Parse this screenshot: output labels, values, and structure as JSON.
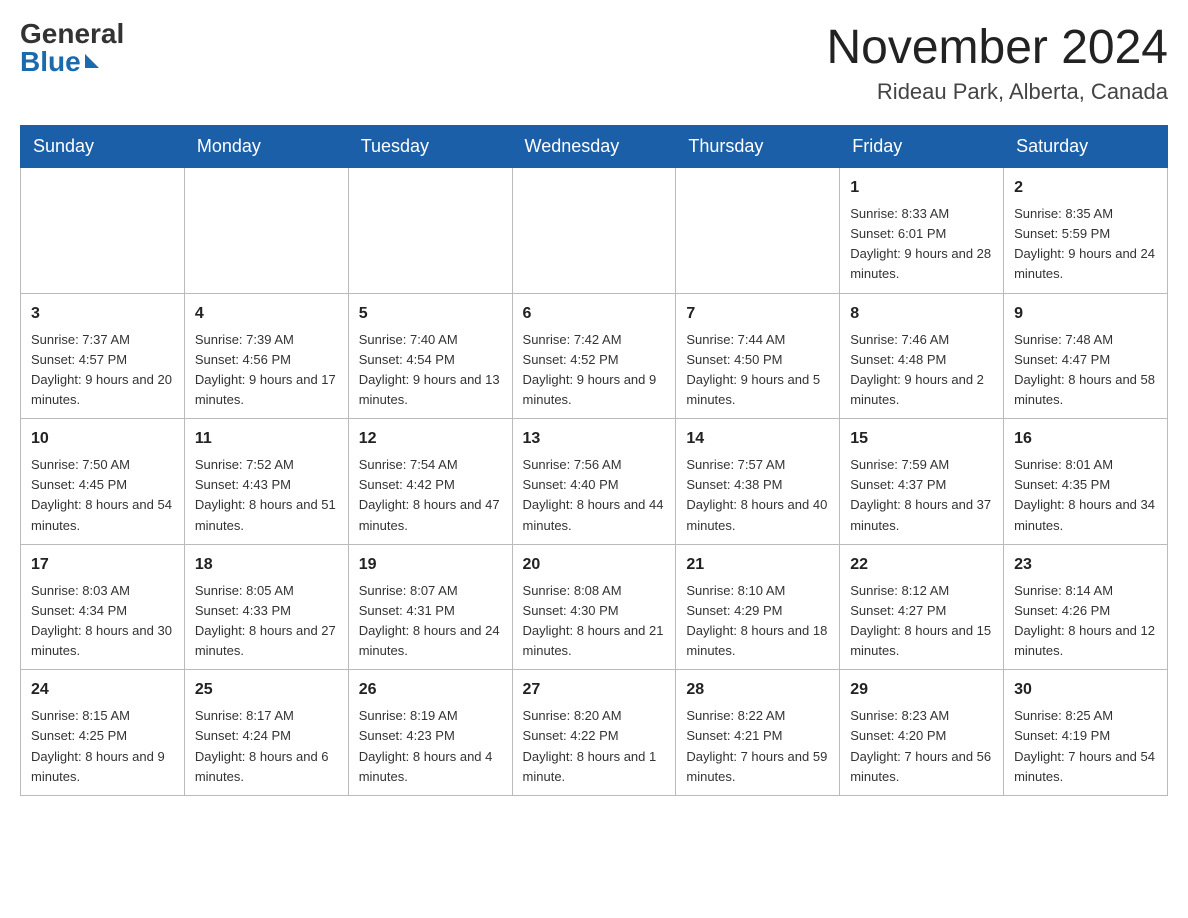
{
  "logo": {
    "general": "General",
    "blue": "Blue"
  },
  "header": {
    "month_title": "November 2024",
    "location": "Rideau Park, Alberta, Canada"
  },
  "weekdays": [
    "Sunday",
    "Monday",
    "Tuesday",
    "Wednesday",
    "Thursday",
    "Friday",
    "Saturday"
  ],
  "weeks": [
    [
      {
        "day": "",
        "info": ""
      },
      {
        "day": "",
        "info": ""
      },
      {
        "day": "",
        "info": ""
      },
      {
        "day": "",
        "info": ""
      },
      {
        "day": "",
        "info": ""
      },
      {
        "day": "1",
        "info": "Sunrise: 8:33 AM\nSunset: 6:01 PM\nDaylight: 9 hours and 28 minutes."
      },
      {
        "day": "2",
        "info": "Sunrise: 8:35 AM\nSunset: 5:59 PM\nDaylight: 9 hours and 24 minutes."
      }
    ],
    [
      {
        "day": "3",
        "info": "Sunrise: 7:37 AM\nSunset: 4:57 PM\nDaylight: 9 hours and 20 minutes."
      },
      {
        "day": "4",
        "info": "Sunrise: 7:39 AM\nSunset: 4:56 PM\nDaylight: 9 hours and 17 minutes."
      },
      {
        "day": "5",
        "info": "Sunrise: 7:40 AM\nSunset: 4:54 PM\nDaylight: 9 hours and 13 minutes."
      },
      {
        "day": "6",
        "info": "Sunrise: 7:42 AM\nSunset: 4:52 PM\nDaylight: 9 hours and 9 minutes."
      },
      {
        "day": "7",
        "info": "Sunrise: 7:44 AM\nSunset: 4:50 PM\nDaylight: 9 hours and 5 minutes."
      },
      {
        "day": "8",
        "info": "Sunrise: 7:46 AM\nSunset: 4:48 PM\nDaylight: 9 hours and 2 minutes."
      },
      {
        "day": "9",
        "info": "Sunrise: 7:48 AM\nSunset: 4:47 PM\nDaylight: 8 hours and 58 minutes."
      }
    ],
    [
      {
        "day": "10",
        "info": "Sunrise: 7:50 AM\nSunset: 4:45 PM\nDaylight: 8 hours and 54 minutes."
      },
      {
        "day": "11",
        "info": "Sunrise: 7:52 AM\nSunset: 4:43 PM\nDaylight: 8 hours and 51 minutes."
      },
      {
        "day": "12",
        "info": "Sunrise: 7:54 AM\nSunset: 4:42 PM\nDaylight: 8 hours and 47 minutes."
      },
      {
        "day": "13",
        "info": "Sunrise: 7:56 AM\nSunset: 4:40 PM\nDaylight: 8 hours and 44 minutes."
      },
      {
        "day": "14",
        "info": "Sunrise: 7:57 AM\nSunset: 4:38 PM\nDaylight: 8 hours and 40 minutes."
      },
      {
        "day": "15",
        "info": "Sunrise: 7:59 AM\nSunset: 4:37 PM\nDaylight: 8 hours and 37 minutes."
      },
      {
        "day": "16",
        "info": "Sunrise: 8:01 AM\nSunset: 4:35 PM\nDaylight: 8 hours and 34 minutes."
      }
    ],
    [
      {
        "day": "17",
        "info": "Sunrise: 8:03 AM\nSunset: 4:34 PM\nDaylight: 8 hours and 30 minutes."
      },
      {
        "day": "18",
        "info": "Sunrise: 8:05 AM\nSunset: 4:33 PM\nDaylight: 8 hours and 27 minutes."
      },
      {
        "day": "19",
        "info": "Sunrise: 8:07 AM\nSunset: 4:31 PM\nDaylight: 8 hours and 24 minutes."
      },
      {
        "day": "20",
        "info": "Sunrise: 8:08 AM\nSunset: 4:30 PM\nDaylight: 8 hours and 21 minutes."
      },
      {
        "day": "21",
        "info": "Sunrise: 8:10 AM\nSunset: 4:29 PM\nDaylight: 8 hours and 18 minutes."
      },
      {
        "day": "22",
        "info": "Sunrise: 8:12 AM\nSunset: 4:27 PM\nDaylight: 8 hours and 15 minutes."
      },
      {
        "day": "23",
        "info": "Sunrise: 8:14 AM\nSunset: 4:26 PM\nDaylight: 8 hours and 12 minutes."
      }
    ],
    [
      {
        "day": "24",
        "info": "Sunrise: 8:15 AM\nSunset: 4:25 PM\nDaylight: 8 hours and 9 minutes."
      },
      {
        "day": "25",
        "info": "Sunrise: 8:17 AM\nSunset: 4:24 PM\nDaylight: 8 hours and 6 minutes."
      },
      {
        "day": "26",
        "info": "Sunrise: 8:19 AM\nSunset: 4:23 PM\nDaylight: 8 hours and 4 minutes."
      },
      {
        "day": "27",
        "info": "Sunrise: 8:20 AM\nSunset: 4:22 PM\nDaylight: 8 hours and 1 minute."
      },
      {
        "day": "28",
        "info": "Sunrise: 8:22 AM\nSunset: 4:21 PM\nDaylight: 7 hours and 59 minutes."
      },
      {
        "day": "29",
        "info": "Sunrise: 8:23 AM\nSunset: 4:20 PM\nDaylight: 7 hours and 56 minutes."
      },
      {
        "day": "30",
        "info": "Sunrise: 8:25 AM\nSunset: 4:19 PM\nDaylight: 7 hours and 54 minutes."
      }
    ]
  ]
}
